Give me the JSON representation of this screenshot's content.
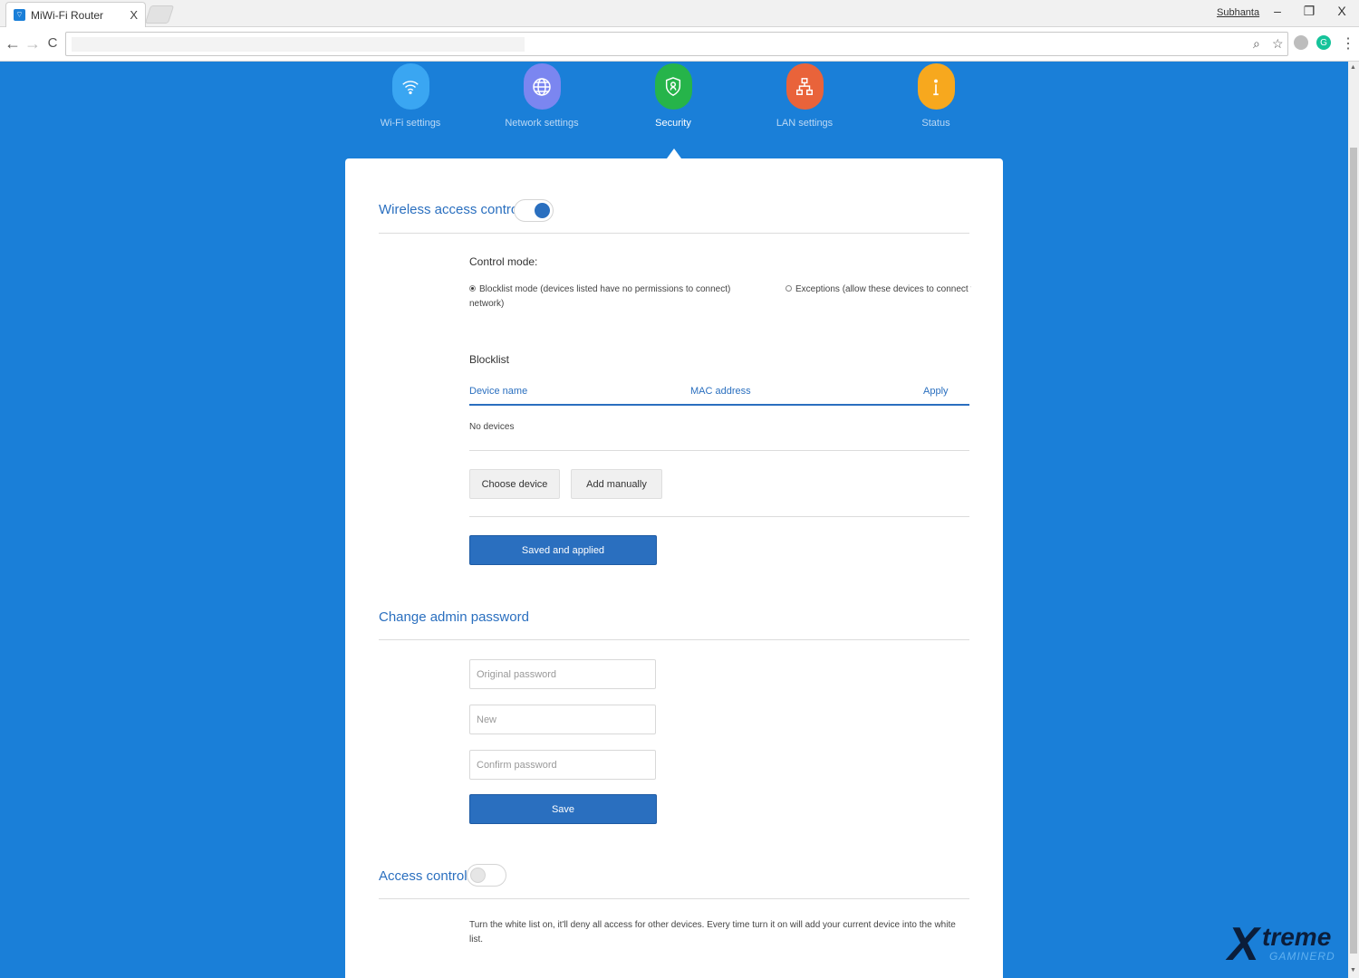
{
  "browser": {
    "tab_title": "MiWi-Fi Router",
    "tab_close": "X",
    "profile_name": "Subhanta",
    "minimize": "–",
    "restore": "❐",
    "close": "X",
    "back": "←",
    "forward": "→",
    "reload": "C",
    "zoom_icon": "⌕",
    "star_icon": "☆",
    "menu": "⋮"
  },
  "nav": {
    "items": [
      {
        "label": "Wi-Fi settings",
        "color": "#3aa6f2",
        "icon": "wifi-icon"
      },
      {
        "label": "Network settings",
        "color": "#7b86f0",
        "icon": "globe-icon"
      },
      {
        "label": "Security",
        "color": "#26b44a",
        "icon": "shield-icon"
      },
      {
        "label": "LAN settings",
        "color": "#e9633a",
        "icon": "network-icon"
      },
      {
        "label": "Status",
        "color": "#f7a81e",
        "icon": "info-icon"
      }
    ],
    "active": "Security"
  },
  "wireless": {
    "title": "Wireless access controls",
    "enabled": true,
    "control_mode_label": "Control mode:",
    "option_blocklist": "Blocklist mode (devices listed have no permissions to connect)",
    "option_blocklist_cont": "network)",
    "option_exceptions": "Exceptions (allow these devices to connect to",
    "selected_mode": "blocklist",
    "blocklist_title": "Blocklist",
    "table": {
      "headers": [
        "Device name",
        "MAC address",
        "Apply"
      ],
      "empty": "No devices"
    },
    "choose_device": "Choose device",
    "add_manually": "Add manually",
    "saved_button": "Saved and applied"
  },
  "password": {
    "title": "Change admin password",
    "original_placeholder": "Original password",
    "new_placeholder": "New",
    "confirm_placeholder": "Confirm password",
    "save_button": "Save"
  },
  "access": {
    "title": "Access control",
    "enabled": false,
    "description": "Turn the white list on, it'll deny all access for other devices. Every time turn it on will add your current device into the white list."
  },
  "watermark": {
    "line1": "X",
    "line2": "treme",
    "line3": "GAMINERD"
  }
}
